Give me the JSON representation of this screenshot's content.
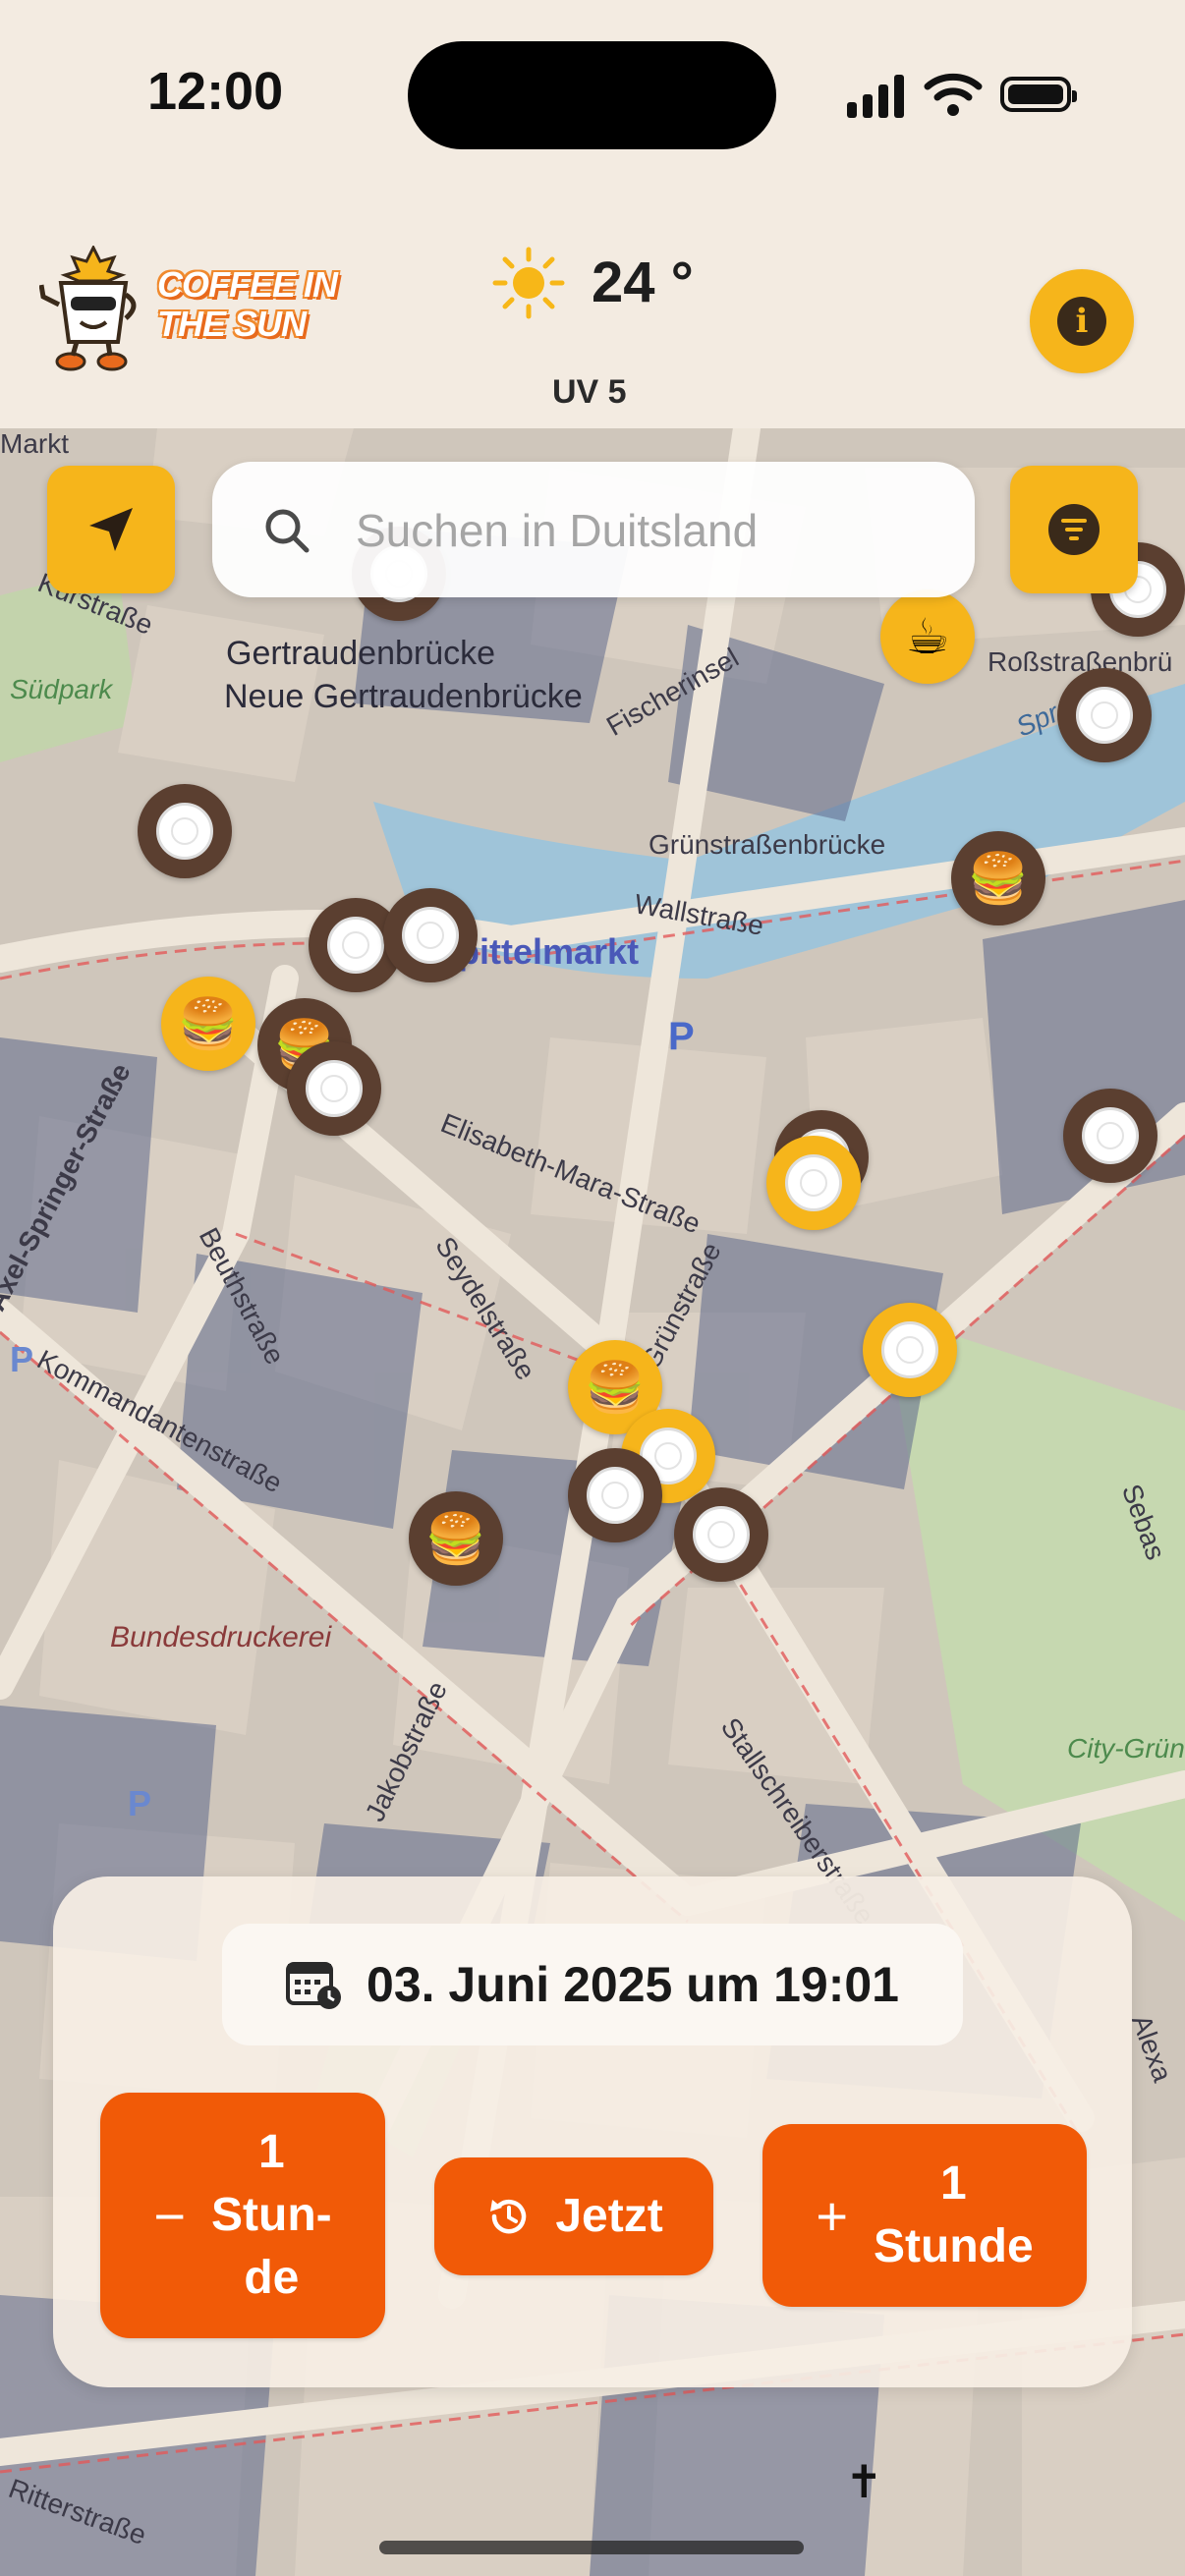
{
  "status_bar": {
    "time": "12:00"
  },
  "header": {
    "logo_text": "COFFEE IN THE SUN",
    "temperature": "24 °",
    "uv": "UV 5"
  },
  "search": {
    "placeholder": "Suchen in Duitsland"
  },
  "map": {
    "streets": [
      "Markt",
      "Kurstraße",
      "Südpark",
      "Gertraudenbrücke",
      "Neue Gertraudenbrücke",
      "Fischerinsel",
      "Roßstraßenbrü",
      "Spreeka",
      "Grünstraßenbrücke",
      "Wallstraße",
      "Spittelmarkt",
      "Elisabeth-Mara-Straße",
      "Axel-Springer-Straße",
      "Beuthstraße",
      "Seydelstraße",
      "Grünstraße",
      "Kommandantenstraße",
      "Bundesdruckerei",
      "Stallschreiberstraße",
      "Jakobstraße",
      "City-Grün",
      "Ritterstraße",
      "Sebas",
      "Alexa"
    ],
    "markers": [
      {
        "kind": "restaurant",
        "sun": false
      },
      {
        "kind": "cafe",
        "sun": true
      },
      {
        "kind": "restaurant",
        "sun": false
      },
      {
        "kind": "restaurant",
        "sun": false
      },
      {
        "kind": "restaurant",
        "sun": false
      },
      {
        "kind": "burger",
        "sun": false
      },
      {
        "kind": "restaurant",
        "sun": false
      },
      {
        "kind": "restaurant",
        "sun": false
      },
      {
        "kind": "burger",
        "sun": true
      },
      {
        "kind": "burger",
        "sun": false
      },
      {
        "kind": "restaurant",
        "sun": false
      },
      {
        "kind": "restaurant",
        "sun": false
      },
      {
        "kind": "restaurant",
        "sun": true
      },
      {
        "kind": "restaurant",
        "sun": false
      },
      {
        "kind": "restaurant",
        "sun": true
      },
      {
        "kind": "burger",
        "sun": true
      },
      {
        "kind": "restaurant",
        "sun": true
      },
      {
        "kind": "restaurant",
        "sun": false
      },
      {
        "kind": "restaurant",
        "sun": false
      },
      {
        "kind": "burger",
        "sun": false
      }
    ]
  },
  "time_panel": {
    "date": "03. Juni 2025 um 19:01",
    "minus_label": "1\nStun-\nde",
    "minus_symbol": "−",
    "now_label": "Jetzt",
    "plus_label": "1\nStunde",
    "plus_symbol": "+"
  },
  "colors": {
    "accent_yellow": "#f6b51b",
    "button_orange": "#f15a07",
    "shade_marker": "#5b3f30",
    "background": "#f3ebe1"
  }
}
